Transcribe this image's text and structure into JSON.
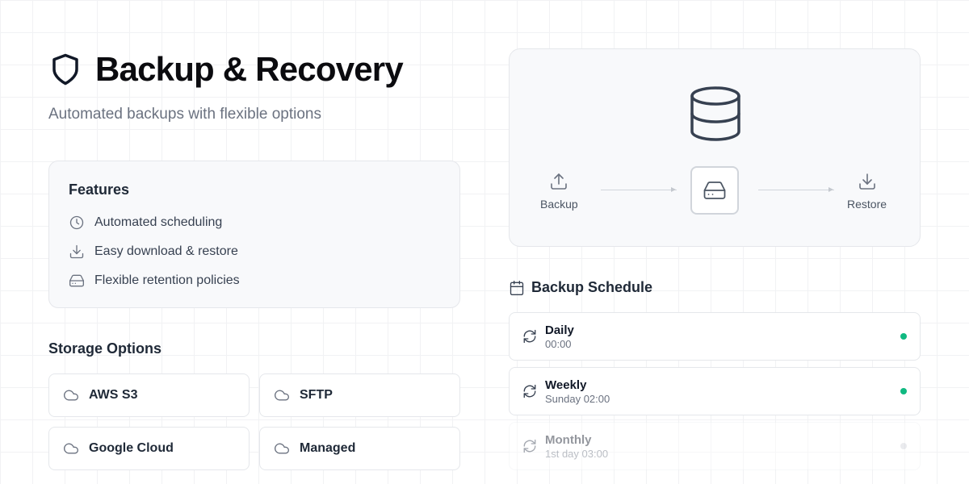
{
  "header": {
    "title": "Backup & Recovery",
    "subtitle": "Automated backups with flexible options",
    "icon": "shield-icon"
  },
  "features": {
    "heading": "Features",
    "items": [
      {
        "label": "Automated scheduling",
        "icon": "clock-icon"
      },
      {
        "label": "Easy download & restore",
        "icon": "download-icon"
      },
      {
        "label": "Flexible retention policies",
        "icon": "hard-drive-icon"
      }
    ]
  },
  "storage": {
    "heading": "Storage Options",
    "options": [
      {
        "label": "AWS S3",
        "icon": "cloud-icon"
      },
      {
        "label": "SFTP",
        "icon": "cloud-icon"
      },
      {
        "label": "Google Cloud",
        "icon": "cloud-icon"
      },
      {
        "label": "Managed",
        "icon": "cloud-icon"
      }
    ]
  },
  "flow": {
    "backup_label": "Backup",
    "restore_label": "Restore",
    "icons": [
      "database-icon",
      "upload-icon",
      "hard-drive-icon",
      "download-icon"
    ]
  },
  "schedule": {
    "heading": "Backup Schedule",
    "icon": "calendar-icon",
    "rows": [
      {
        "name": "Daily",
        "time": "00:00",
        "active": true
      },
      {
        "name": "Weekly",
        "time": "Sunday 02:00",
        "active": true
      },
      {
        "name": "Monthly",
        "time": "1st day 03:00",
        "active": false
      }
    ]
  },
  "colors": {
    "active": "#10b981",
    "inactive": "#d1d5db",
    "text_primary": "#111827",
    "text_muted": "#6b7280"
  }
}
